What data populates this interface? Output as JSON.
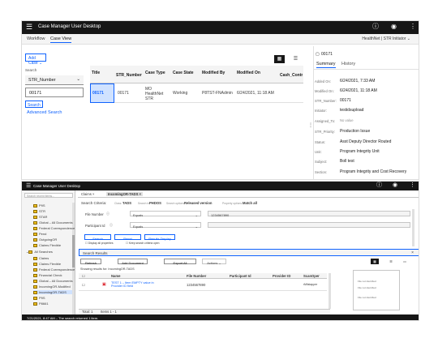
{
  "top": {
    "app_title": "Case Manager User Desktop",
    "tabs": [
      {
        "label": "Workflow"
      },
      {
        "label": "Case View"
      }
    ],
    "solution_selector": "HealthNet | STR Initiator ⌄",
    "add_case_label": "Add Case ⌄",
    "search_label": "Search",
    "search_property": "STR_Number",
    "search_value": "00171",
    "search_button": "Search",
    "advanced_search": "Advanced Search",
    "grid": {
      "columns": [
        "Title",
        "STR_Number",
        "Case Type",
        "Case State",
        "Modified By",
        "Modified On",
        "Cash_Contrib"
      ],
      "row": {
        "title": "00171",
        "str": "00171",
        "case_type": "MO HealthNet STR",
        "state": "Working",
        "modified_by": "P8TST-FNAdmin",
        "modified_on": "6/24/2021, 11:18 AM"
      }
    },
    "details": {
      "header": "00171",
      "tabs": [
        "Summary",
        "History"
      ],
      "props": [
        {
          "label": "Added On:",
          "value": "6/24/2021, 7:33 AM"
        },
        {
          "label": "Modified On:",
          "value": "6/24/2021, 11:18 AM"
        },
        {
          "label": "STR_Number:",
          "value": "00171"
        },
        {
          "label": "Initiator:",
          "value": "testidsupload"
        },
        {
          "label": "Assigned_To:",
          "value": "No value"
        },
        {
          "label": "STR_Priority:",
          "value": "Production Issue"
        },
        {
          "label": "Status:",
          "value": "Asst Deputy Director Routed"
        },
        {
          "label": "Unit:",
          "value": "Program Integrity Unit"
        },
        {
          "label": "Subject:",
          "value": "Boll test"
        },
        {
          "label": "Section:",
          "value": "Program Integrity and Cost Recovery"
        }
      ]
    }
  },
  "bottom": {
    "app_title": "Case Manager User Desktop",
    "filter_placeholder": "Search recent items...",
    "tree": [
      {
        "label": "P9S"
      },
      {
        "label": "STR"
      },
      {
        "label": "STAR"
      },
      {
        "label": "Global – All Documents"
      },
      {
        "label": "Federal Correspondence"
      },
      {
        "label": "Pend"
      },
      {
        "label": "OutgoingOR"
      },
      {
        "label": "Claims Flexible"
      },
      {
        "label": "All Searches"
      },
      {
        "label": "Claims"
      },
      {
        "label": "Claims Flexible"
      },
      {
        "label": "Federal Correspondence"
      },
      {
        "label": "Financial Check"
      },
      {
        "label": "Global – All Documents"
      },
      {
        "label": "IncomingOR-Modified"
      },
      {
        "label": "IncomingOR-TADS"
      },
      {
        "label": "P9S"
      },
      {
        "label": "P8661"
      }
    ],
    "doc_tabs": [
      {
        "label": "Claims"
      },
      {
        "label": "IncomingOR-TADS"
      }
    ],
    "criteria": {
      "label": "Search Criteria:",
      "class_label": "Class:",
      "class_value": "TADS",
      "search_in_label": "Search in:",
      "search_in": "PHDOS",
      "versions_label": "Search options:",
      "versions": "Released version",
      "property_label": "Property options:",
      "property": "Match all",
      "rows": [
        {
          "name": "File Number",
          "op": "Equals",
          "value": "1234567890"
        },
        {
          "name": "Participant Id",
          "op": "Equals",
          "value": ""
        }
      ],
      "buttons": [
        "Search",
        "Reset",
        "Results Display"
      ],
      "check1": "Display all properties",
      "check2": "Keep search criteria open"
    },
    "results": {
      "header": "Search Results",
      "toolbar": [
        "Refresh",
        "Add Document",
        "Export All",
        "Actions ⌄"
      ],
      "showing": "Showing results for: IncomingOR-TADS",
      "columns": [
        "Name",
        "File Number",
        "Participant Id",
        "Provider ID",
        "ScanOper"
      ],
      "row": {
        "name": "TEST 1 – Item EMPTY value in Provider ID field",
        "file": "1234567890",
        "scan": "rMilstapper"
      },
      "footer_total": "Total: 1",
      "footer_items": "Items 1 - 1"
    },
    "preview": {
      "lines": [
        "File not identified",
        "File not identified",
        "File not identified"
      ]
    },
    "status": "7/21/2021, 8:47 AM – The search returned 1 item."
  }
}
